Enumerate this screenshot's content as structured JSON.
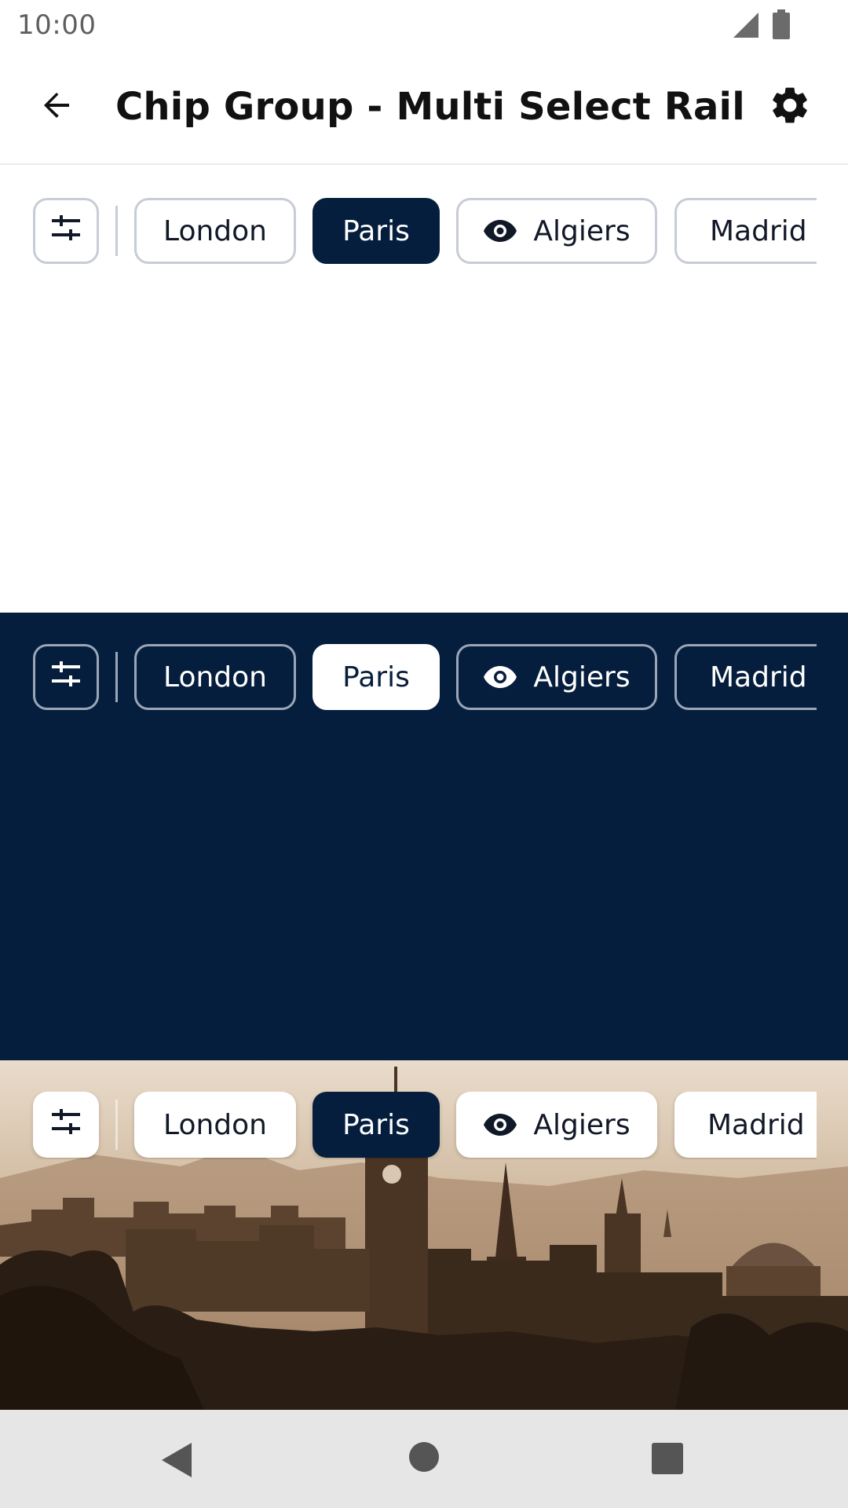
{
  "status_bar": {
    "time": "10:00",
    "icons": [
      "signal-icon",
      "battery-icon"
    ]
  },
  "app_bar": {
    "title": "Chip Group - Multi Select Rail",
    "back_icon": "arrow-back-icon",
    "settings_icon": "gear-icon"
  },
  "chips": {
    "filter_icon": "sliders-icon",
    "items": [
      {
        "label": "London",
        "selected": false,
        "icon": null
      },
      {
        "label": "Paris",
        "selected": true,
        "icon": null
      },
      {
        "label": "Algiers",
        "selected": false,
        "icon": "eye-icon"
      },
      {
        "label": "Madrid",
        "selected": false,
        "icon": null
      }
    ]
  },
  "themes": {
    "light": {
      "background": "#ffffff",
      "selected_chip": "#061e3d"
    },
    "dark": {
      "background": "#061e3d",
      "selected_chip": "#ffffff"
    },
    "photo": {
      "background": "city-skyline-image",
      "selected_chip": "#061e3d"
    }
  },
  "nav_bar": {
    "icons": [
      "nav-back-icon",
      "nav-home-icon",
      "nav-recents-icon"
    ]
  }
}
